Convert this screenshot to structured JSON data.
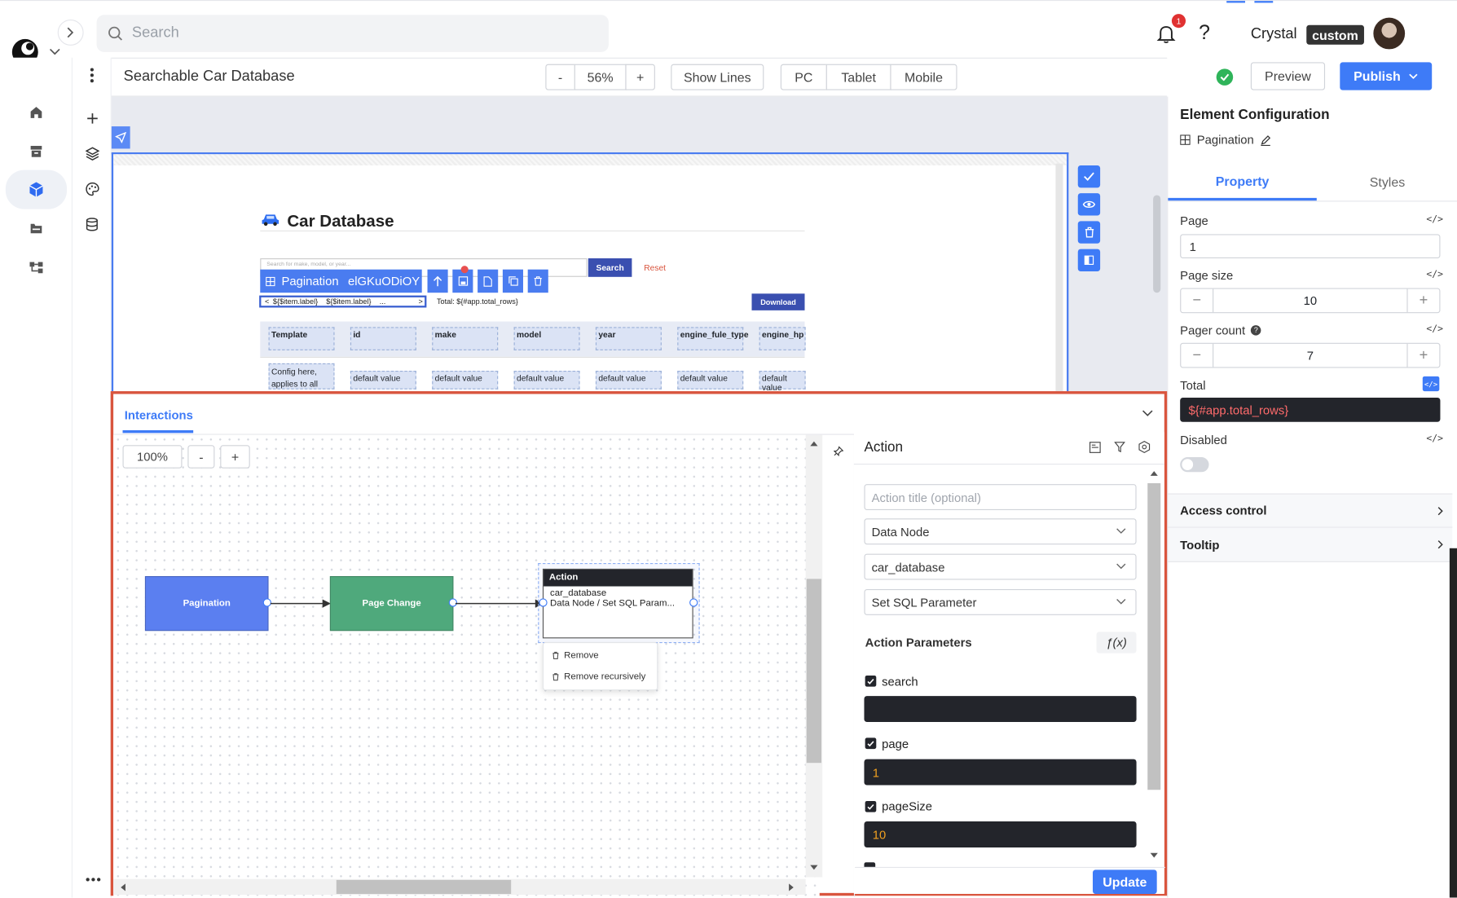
{
  "topbar": {
    "search_placeholder": "Search",
    "notification_count": "1",
    "help": "?",
    "user_name": "Crystal",
    "user_badge": "custom"
  },
  "editbar": {
    "title": "Searchable Car Database",
    "zoom_minus": "-",
    "zoom_value": "56%",
    "zoom_plus": "+",
    "show_lines": "Show Lines",
    "devices": [
      "PC",
      "Tablet",
      "Mobile"
    ],
    "preview": "Preview",
    "publish": "Publish"
  },
  "app": {
    "heading": "Car Database",
    "search_placeholder": "Search for make, model, or year...",
    "search_btn": "Search",
    "reset": "Reset",
    "pagination_chip_label": "Pagination",
    "pagination_chip_id": "elGKuODiOY",
    "pager_text": "${$item.label}    ${$item.label}    ...",
    "total_text": "Total: ${#app.total_rows}",
    "download": "Download",
    "columns": [
      "Template",
      "id",
      "make",
      "model",
      "year",
      "engine_fule_type",
      "engine_hp"
    ],
    "template_cell": "Config here, applies to all",
    "default_value": "default value"
  },
  "interactions": {
    "tab": "Interactions",
    "zoom": "100%",
    "zoom_minus": "-",
    "zoom_plus": "+",
    "nodes": {
      "pagination": "Pagination",
      "page_change": "Page Change",
      "action_title": "Action",
      "action_line1": "car_database",
      "action_line2": "Data Node / Set SQL Param..."
    },
    "context_menu": [
      "Remove",
      "Remove recursively"
    ]
  },
  "action_panel": {
    "title": "Action",
    "title_placeholder": "Action title (optional)",
    "select1": "Data Node",
    "select2": "car_database",
    "select3": "Set SQL Parameter",
    "params_label": "Action Parameters",
    "fx": "ƒ(x)",
    "params": [
      {
        "name": "search",
        "value": ""
      },
      {
        "name": "page",
        "value": "1"
      },
      {
        "name": "pageSize",
        "value": "10"
      }
    ],
    "update": "Update"
  },
  "config": {
    "title": "Element Configuration",
    "element": "Pagination",
    "tab_property": "Property",
    "tab_styles": "Styles",
    "page_label": "Page",
    "page_value": "1",
    "page_size_label": "Page size",
    "page_size_value": "10",
    "pager_count_label": "Pager count",
    "pager_count_value": "7",
    "total_label": "Total",
    "total_value": "${#app.total_rows}",
    "disabled_label": "Disabled",
    "disabled": false,
    "access_control": "Access control",
    "tooltip": "Tooltip"
  },
  "colors": {
    "primary": "#3e7bf7",
    "pagination_node": "#5b7ff0",
    "page_change_node": "#4fa97c",
    "highlight": "#d9553e",
    "success": "#2fb45a"
  }
}
